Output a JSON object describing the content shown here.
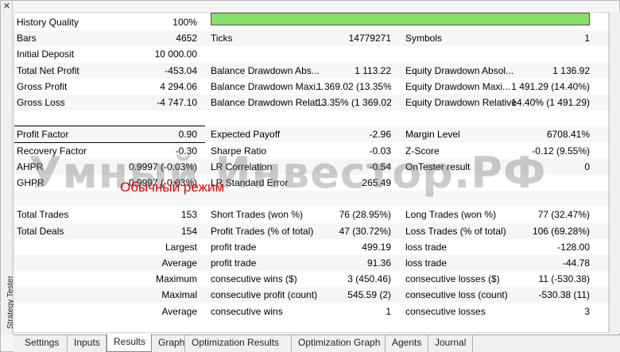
{
  "side_panel": {
    "label": "Strategy Tester",
    "close_glyph": "✕"
  },
  "rows": [
    {
      "c1_label": "History Quality",
      "c1_value": "100%",
      "bar_fill_fraction": 1.0
    },
    {
      "c1_label": "Bars",
      "c1_value": "4652",
      "c2_label": "Ticks",
      "c2_value": "14779271",
      "c3_label": "Symbols",
      "c3_value": "1"
    },
    {
      "c1_label": "Initial Deposit",
      "c1_value": "10 000.00"
    },
    {
      "c1_label": "Total Net Profit",
      "c1_value": "-453.04",
      "c2_label": "Balance Drawdown Abs...",
      "c2_value": "1 113.22",
      "c3_label": "Equity Drawdown Absol...",
      "c3_value": "1 136.92"
    },
    {
      "c1_label": "Gross Profit",
      "c1_value": "4 294.06",
      "c2_label": "Balance Drawdown Maxi...",
      "c2_value": "1 369.02 (13.35%)",
      "c3_label": "Equity Drawdown Maxi...",
      "c3_value": "1 491.29 (14.40%)"
    },
    {
      "c1_label": "Gross Loss",
      "c1_value": "-4 747.10",
      "c2_label": "Balance Drawdown Relat...",
      "c2_value": "13.35% (1 369.02)",
      "c3_label": "Equity Drawdown Relative",
      "c3_value": "14.40% (1 491.29)"
    },
    {},
    {
      "c1_label": "Profit Factor",
      "c1_value": "0.90",
      "c2_label": "Expected Payoff",
      "c2_value": "-2.96",
      "c3_label": "Margin Level",
      "c3_value": "6708.41%"
    },
    {
      "c1_label": "Recovery Factor",
      "c1_value": "-0.30",
      "c2_label": "Sharpe Ratio",
      "c2_value": "-0.03",
      "c3_label": "Z-Score",
      "c3_value": "-0.12 (9.55%)"
    },
    {
      "c1_label": "AHPR",
      "c1_value": "0.9997 (-0.03%)",
      "c2_label": "LR Correlation",
      "c2_value": "-0.54",
      "c3_label": "OnTester result",
      "c3_value": "0"
    },
    {
      "c1_label": "GHPR",
      "c1_value": "0.9997 (-0.03%)",
      "c2_label": "LR Standard Error",
      "c2_value": "265.49"
    },
    {},
    {
      "c1_label": "Total Trades",
      "c1_value": "153",
      "c2_label": "Short Trades (won %)",
      "c2_value": "76 (28.95%)",
      "c3_label": "Long Trades (won %)",
      "c3_value": "77 (32.47%)"
    },
    {
      "c1_label": "Total Deals",
      "c1_value": "154",
      "c2_label": "Profit Trades (% of total)",
      "c2_value": "47 (30.72%)",
      "c3_label": "Loss Trades (% of total)",
      "c3_value": "106 (69.28%)"
    },
    {
      "c1_value": "Largest",
      "c2_label": "profit trade",
      "c2_value": "499.19",
      "c3_label": "loss trade",
      "c3_value": "-128.00"
    },
    {
      "c1_value": "Average",
      "c2_label": "profit trade",
      "c2_value": "91.36",
      "c3_label": "loss trade",
      "c3_value": "-44.78"
    },
    {
      "c1_value": "Maximum",
      "c2_label": "consecutive wins ($)",
      "c2_value": "3 (450.46)",
      "c3_label": "consecutive losses ($)",
      "c3_value": "11 (-530.38)"
    },
    {
      "c1_value": "Maximal",
      "c2_label": "consecutive profit (count)",
      "c2_value": "545.59 (2)",
      "c3_label": "consecutive loss (count)",
      "c3_value": "-530.38 (11)"
    },
    {
      "c1_value": "Average",
      "c2_label": "consecutive wins",
      "c2_value": "1",
      "c3_label": "consecutive losses",
      "c3_value": "3"
    }
  ],
  "watermark": "Умный Инвестор.РФ",
  "annotation": "Обычный режим",
  "tabs": [
    "Settings",
    "Inputs",
    "Results",
    "Graph",
    "Optimization Results",
    "Optimization Graph",
    "Agents",
    "Journal"
  ],
  "active_tab": "Results",
  "colors": {
    "quality_bar": "#86e067",
    "annotation": "#e40000",
    "highlight_box": "#000000"
  }
}
